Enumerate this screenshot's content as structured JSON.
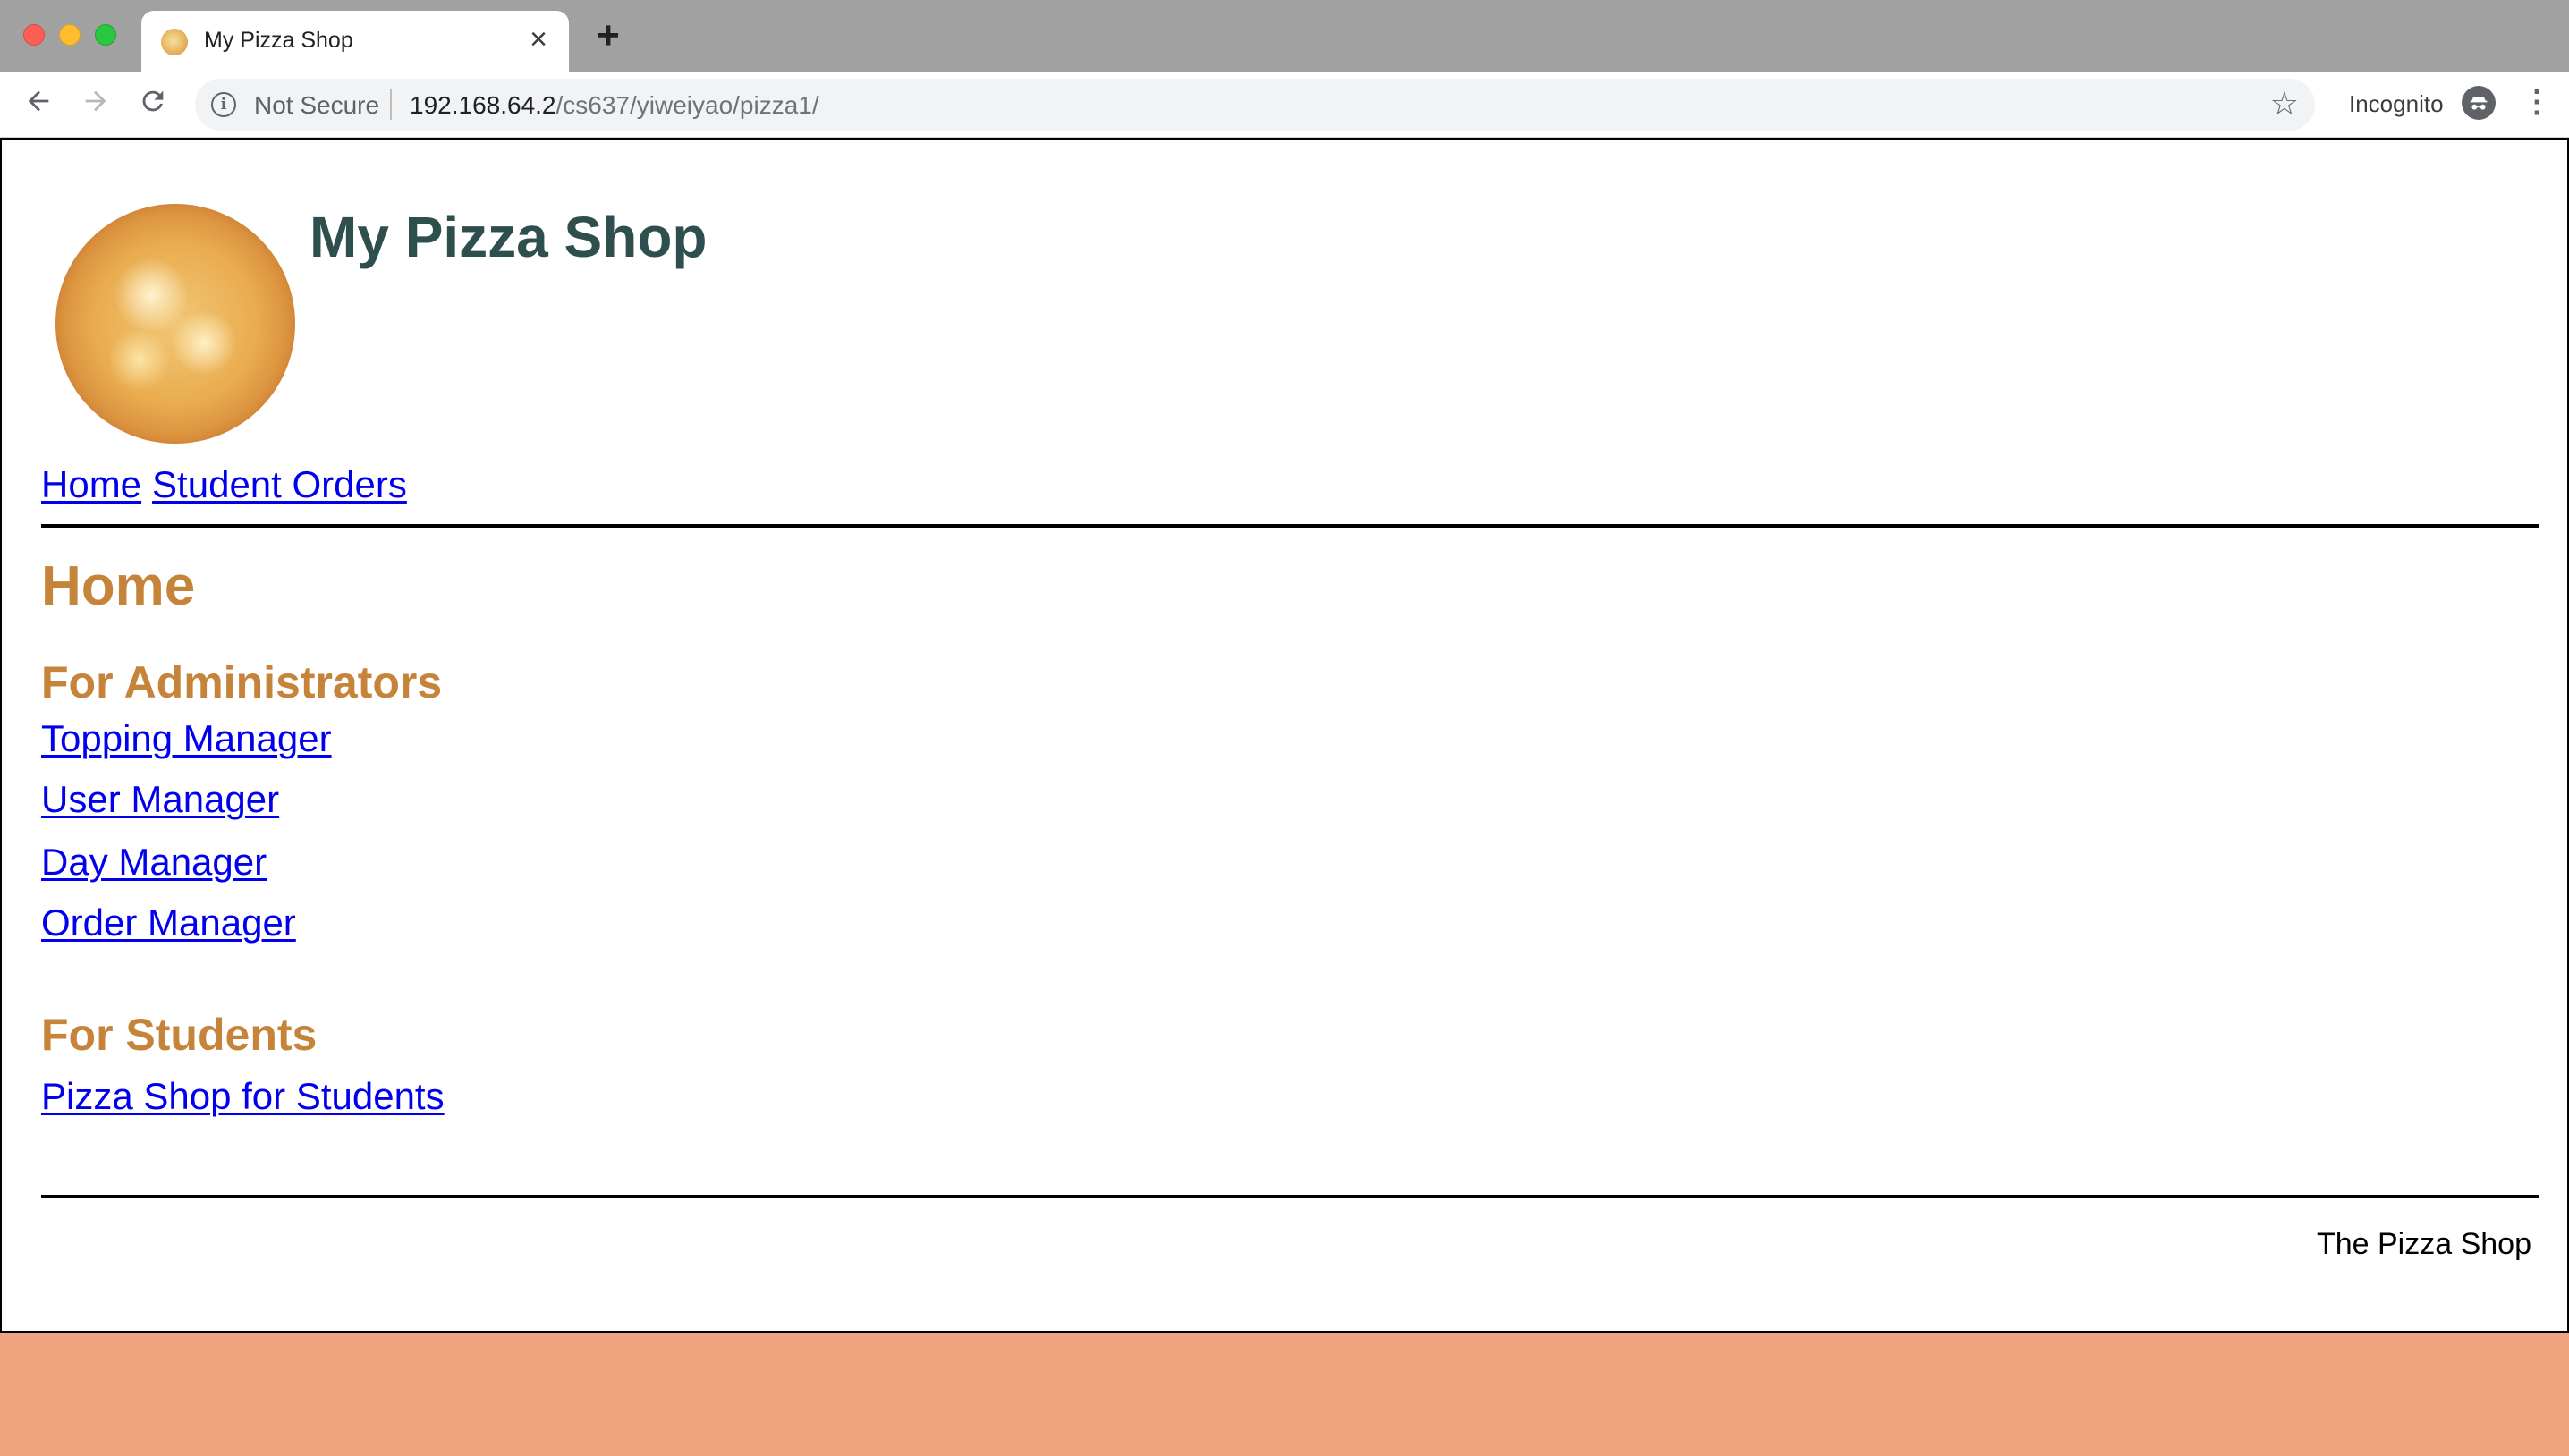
{
  "browser": {
    "tab_title": "My Pizza Shop",
    "tab_close_glyph": "×",
    "new_tab_glyph": "+",
    "security_label": "Not Secure",
    "url_host": "192.168.64.2",
    "url_path": "/cs637/yiweiyao/pizza1/",
    "incognito_label": "Incognito",
    "icons": {
      "back": "back-arrow-icon",
      "forward": "forward-arrow-icon",
      "reload": "reload-icon",
      "info": "info-icon",
      "star": "bookmark-star-icon",
      "incognito": "incognito-icon",
      "menu": "kebab-menu-icon"
    }
  },
  "header": {
    "title": "My Pizza Shop",
    "logo": "pizza-logo-image"
  },
  "nav": {
    "home": "Home",
    "student_orders": "Student Orders"
  },
  "main": {
    "heading": "Home",
    "admin_section": {
      "title": "For Administrators",
      "links": [
        "Topping Manager",
        "User Manager",
        "Day Manager",
        "Order Manager"
      ]
    },
    "student_section": {
      "title": "For Students",
      "links": [
        "Pizza Shop for Students"
      ]
    }
  },
  "footer": {
    "text": "The Pizza Shop"
  },
  "colors": {
    "heading_accent": "#c6843a",
    "site_title": "#2f4f4f",
    "link": "#0000ee",
    "desktop_background": "#f0a47f"
  }
}
